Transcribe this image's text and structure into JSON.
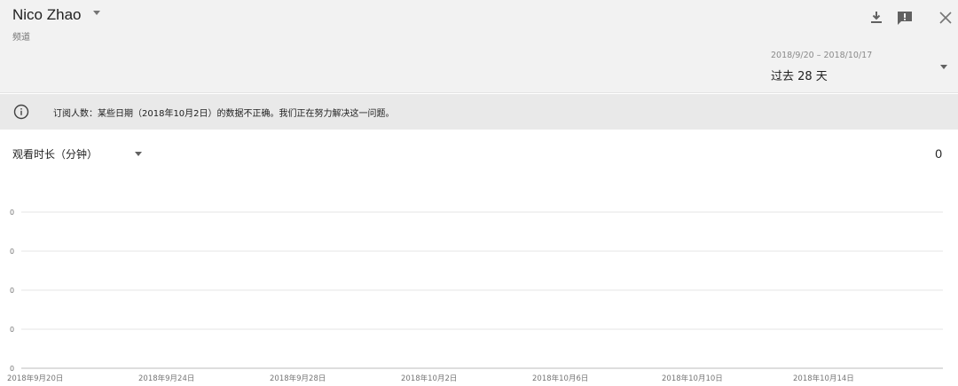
{
  "header": {
    "channel_name": "Nico Zhao",
    "channel_type": "频道",
    "icons": {
      "download": "download-icon",
      "feedback": "feedback-icon",
      "close": "close-icon"
    }
  },
  "date_range": {
    "dates": "2018/9/20 – 2018/10/17",
    "label": "过去 28 天"
  },
  "notice": {
    "icon": "info-icon",
    "text": "订阅人数：某些日期（2018年10月2日）的数据不正确。我们正在努力解决这一问题。"
  },
  "metric": {
    "label": "观看时长（分钟）",
    "total": "0"
  },
  "colors": {
    "header_bg": "#f2f2f2",
    "notice_bg": "#e9e9e9",
    "gridline": "#e6e6e6",
    "axis": "#bdbdbd"
  },
  "chart_data": {
    "type": "line",
    "ylabel": "",
    "xlabel": "",
    "yticks": [
      "0",
      "0",
      "0",
      "0",
      "0"
    ],
    "x_ticks": [
      "2018年9月20日",
      "2018年9月24日",
      "2018年9月28日",
      "2018年10月2日",
      "2018年10月6日",
      "2018年10月10日",
      "2018年10月14日"
    ],
    "x": [
      "2018-09-20",
      "2018-09-21",
      "2018-09-22",
      "2018-09-23",
      "2018-09-24",
      "2018-09-25",
      "2018-09-26",
      "2018-09-27",
      "2018-09-28",
      "2018-09-29",
      "2018-09-30",
      "2018-10-01",
      "2018-10-02",
      "2018-10-03",
      "2018-10-04",
      "2018-10-05",
      "2018-10-06",
      "2018-10-07",
      "2018-10-08",
      "2018-10-09",
      "2018-10-10",
      "2018-10-11",
      "2018-10-12",
      "2018-10-13",
      "2018-10-14",
      "2018-10-15",
      "2018-10-16",
      "2018-10-17"
    ],
    "values": [
      0,
      0,
      0,
      0,
      0,
      0,
      0,
      0,
      0,
      0,
      0,
      0,
      0,
      0,
      0,
      0,
      0,
      0,
      0,
      0,
      0,
      0,
      0,
      0,
      0,
      0,
      0,
      0
    ],
    "grid": true
  }
}
